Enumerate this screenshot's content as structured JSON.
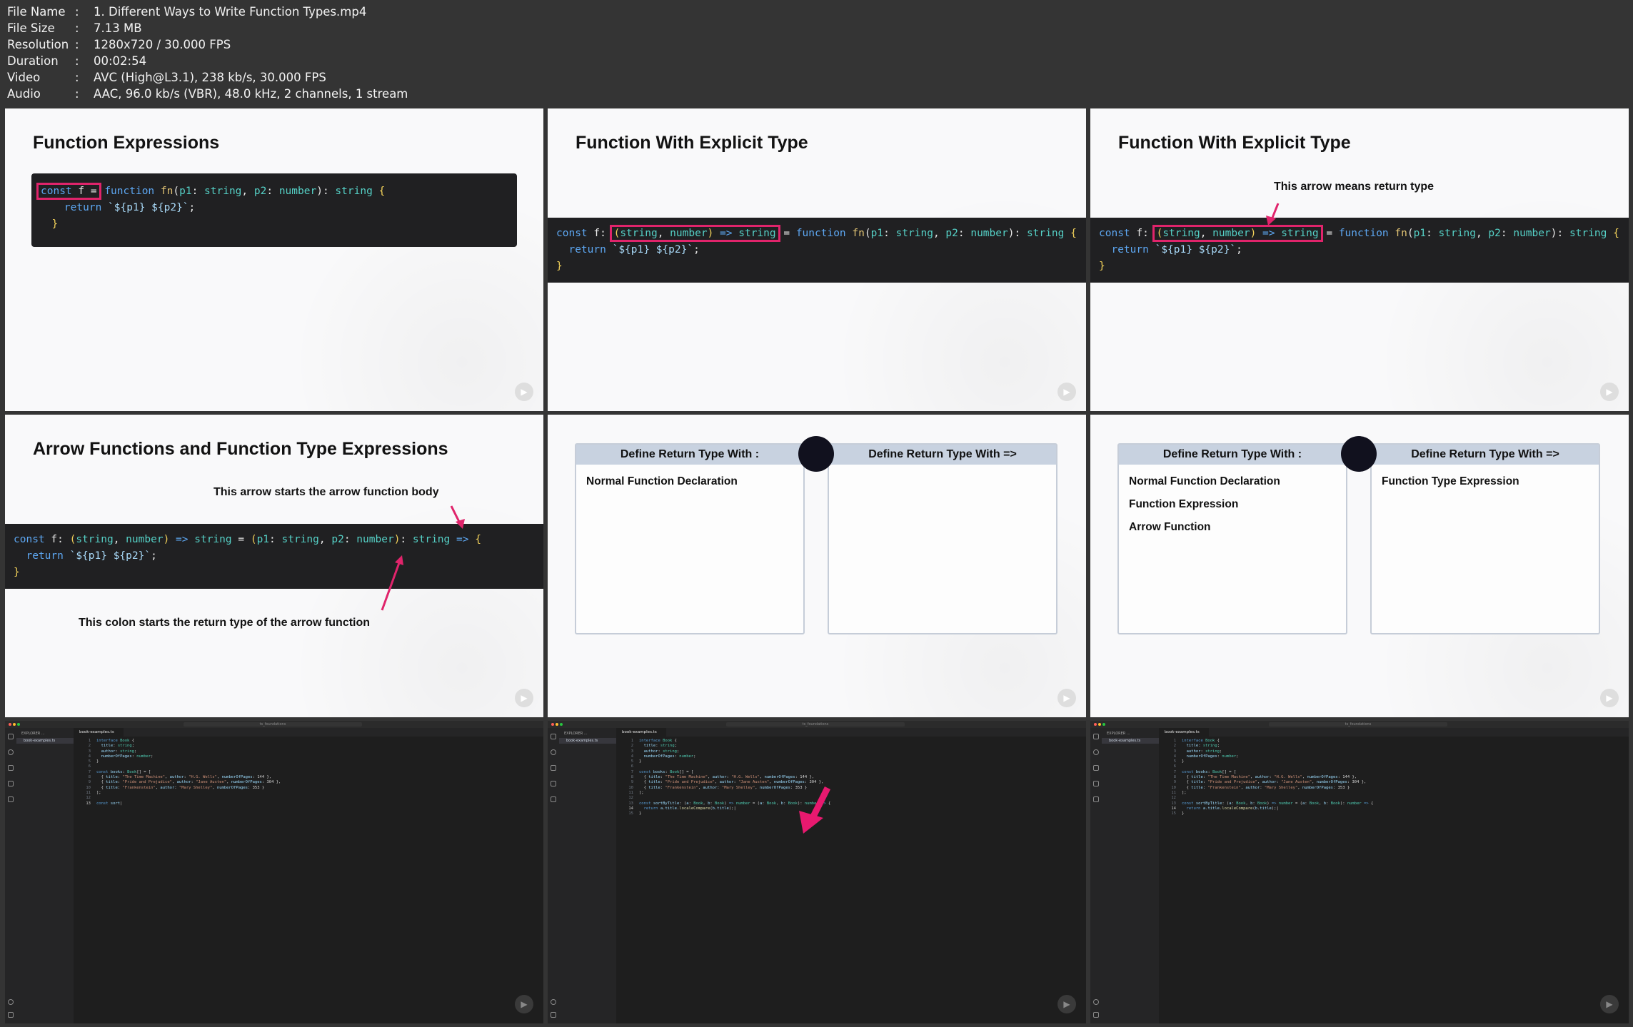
{
  "file_info": [
    {
      "key": "File Name",
      "value": "1. Different Ways to Write Function Types.mp4"
    },
    {
      "key": "File Size",
      "value": "7.13 MB"
    },
    {
      "key": "Resolution",
      "value": "1280x720 / 30.000 FPS"
    },
    {
      "key": "Duration",
      "value": "00:02:54"
    },
    {
      "key": "Video",
      "value": "AVC (High@L3.1), 238 kb/s, 30.000 FPS"
    },
    {
      "key": "Audio",
      "value": "AAC, 96.0 kb/s (VBR), 48.0 kHz, 2 channels, 1 stream"
    }
  ],
  "tiles": {
    "t1": {
      "title": "Function Expressions"
    },
    "t2": {
      "title": "Function With Explicit Type"
    },
    "t3": {
      "title": "Function With Explicit Type",
      "annotation": "This arrow means return type"
    },
    "t4": {
      "title": "Arrow Functions and Function Type Expressions",
      "annotation_top": "This arrow starts the arrow function body",
      "annotation_bottom": "This colon starts the return type of the arrow function"
    },
    "t5": {
      "left_header": "Define Return Type With :",
      "right_header": "Define Return Type With =>",
      "left_items": [
        "Normal Function Declaration"
      ],
      "right_items": []
    },
    "t6": {
      "left_header": "Define Return Type With :",
      "right_header": "Define Return Type With =>",
      "left_items": [
        "Normal Function Declaration",
        "Function Expression",
        "Arrow Function"
      ],
      "right_items": [
        "Function Type Expression"
      ]
    },
    "editor": {
      "explorer_label": "EXPLORER ...",
      "file_name": "book-examples.ts",
      "tab_label": "book-examples.ts",
      "search_label": "ts_foundations"
    }
  },
  "colors": {
    "highlight": "#e0246b",
    "code_bg": "#202022",
    "box_header": "#c8d2e0"
  }
}
